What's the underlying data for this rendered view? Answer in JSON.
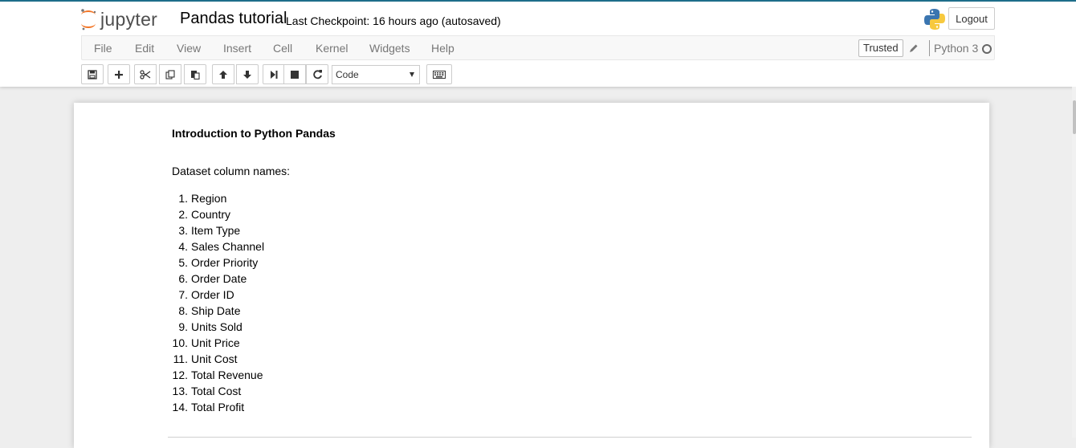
{
  "header": {
    "logo_text": "jupyter",
    "notebook_name": "Pandas tutorial",
    "checkpoint": "Last Checkpoint: 16 hours ago (autosaved)",
    "logout_label": "Logout"
  },
  "menubar": {
    "items": [
      "File",
      "Edit",
      "View",
      "Insert",
      "Cell",
      "Kernel",
      "Widgets",
      "Help"
    ],
    "trusted_label": "Trusted",
    "kernel_name": "Python 3"
  },
  "toolbar": {
    "buttons": [
      "save-icon",
      "plus-icon",
      "cut-icon",
      "copy-icon",
      "paste-icon",
      "arrow-up-icon",
      "arrow-down-icon",
      "step-forward-icon",
      "stop-icon",
      "restart-icon",
      "keyboard-icon"
    ],
    "cell_type": "Code"
  },
  "notebook": {
    "title": "Introduction to Python Pandas",
    "dataset_label": "Dataset column names:",
    "columns": [
      {
        "num": "1.",
        "name": "Region"
      },
      {
        "num": "2.",
        "name": "Country"
      },
      {
        "num": "3.",
        "name": "Item Type"
      },
      {
        "num": "4.",
        "name": "Sales Channel"
      },
      {
        "num": "5.",
        "name": "Order Priority"
      },
      {
        "num": "6.",
        "name": "Order Date"
      },
      {
        "num": "7.",
        "name": "Order ID"
      },
      {
        "num": "8.",
        "name": "Ship Date"
      },
      {
        "num": "9.",
        "name": "Units Sold"
      },
      {
        "num": "10.",
        "name": "Unit Price"
      },
      {
        "num": "11.",
        "name": "Unit Cost"
      },
      {
        "num": "12.",
        "name": "Total Revenue"
      },
      {
        "num": "13.",
        "name": "Total Cost"
      },
      {
        "num": "14.",
        "name": "Total Profit"
      }
    ]
  },
  "colors": {
    "accent": "#f37626",
    "header_border": "#1e6d8a"
  }
}
